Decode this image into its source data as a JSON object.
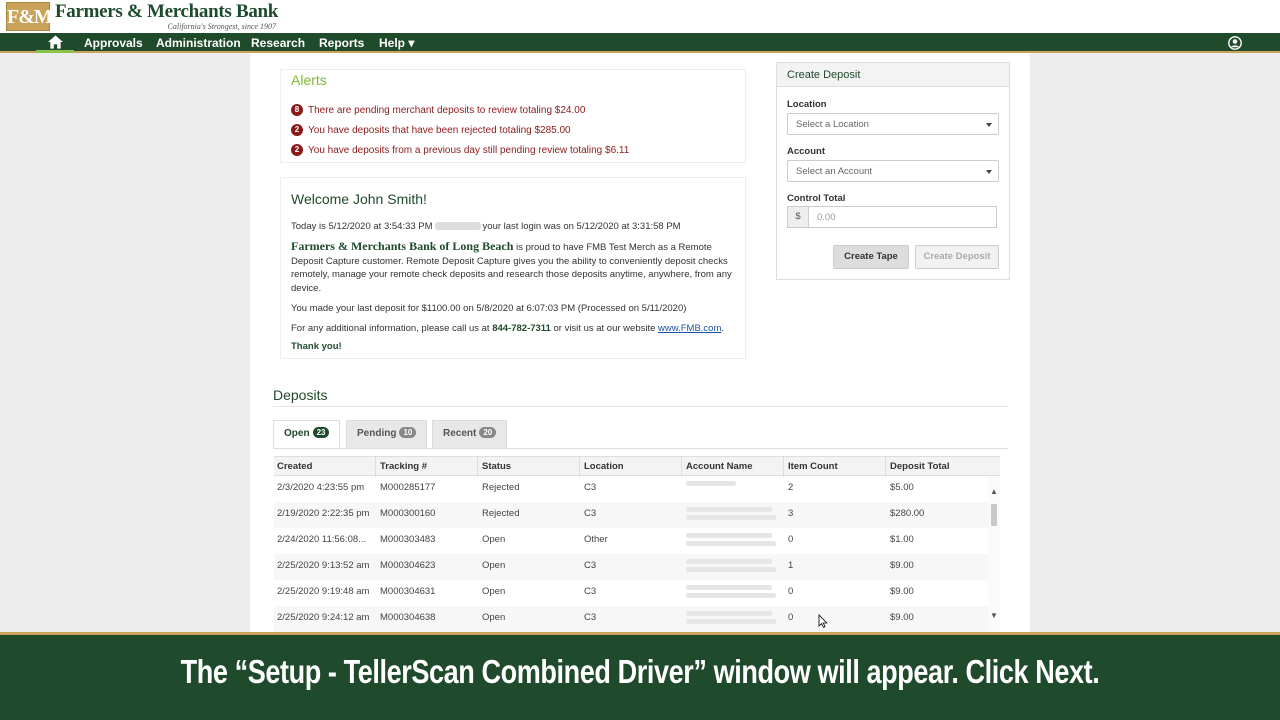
{
  "header": {
    "logo_mark": "F&M",
    "bank_name": "Farmers & Merchants Bank",
    "tagline": "California's Strongest, since 1907"
  },
  "nav": {
    "items": [
      "Approvals",
      "Administration",
      "Research",
      "Reports",
      "Help ▾"
    ]
  },
  "alerts": {
    "title": "Alerts",
    "items": [
      {
        "count": "8",
        "text": "There are pending merchant deposits to review totaling $24.00"
      },
      {
        "count": "2",
        "text": "You have deposits that have been rejected totaling $285.00"
      },
      {
        "count": "2",
        "text": "You have deposits from a previous day still pending review totaling $6.11"
      }
    ]
  },
  "welcome": {
    "title": "Welcome John Smith!",
    "today_prefix": "Today is 5/12/2020 at 3:54:33 PM",
    "today_suffix": "your last login was on 5/12/2020 at 3:31:58 PM",
    "bank_full": "Farmers & Merchants Bank of Long Beach",
    "intro": "is proud to have FMB Test Merch as a Remote Deposit Capture customer. Remote Deposit Capture gives you the ability to conveniently deposit checks remotely, manage your remote check deposits and research those deposits anytime, anywhere, from any device.",
    "last_deposit": "You made your last deposit for $1100.00 on 5/8/2020 at 6:07:03 PM (Processed on 5/11/2020)",
    "info_prefix": "For any additional information, please call us at",
    "phone": "844-782-7311",
    "info_mid": "or visit us at our website",
    "website": "www.FMB.com",
    "thanks": "Thank you!"
  },
  "create_deposit": {
    "title": "Create Deposit",
    "location_label": "Location",
    "location_placeholder": "Select a Location",
    "account_label": "Account",
    "account_placeholder": "Select an Account",
    "control_label": "Control Total",
    "currency": "$",
    "control_placeholder": "0.00",
    "create_tape": "Create Tape",
    "create_deposit": "Create Deposit"
  },
  "deposits": {
    "title": "Deposits",
    "tabs": [
      {
        "label": "Open",
        "count": "23"
      },
      {
        "label": "Pending",
        "count": "10"
      },
      {
        "label": "Recent",
        "count": "20"
      }
    ],
    "columns": [
      "Created",
      "Tracking #",
      "Status",
      "Location",
      "Account Name",
      "Item Count",
      "Deposit Total"
    ],
    "rows": [
      {
        "created": "2/3/2020 4:23:55 pm",
        "tracking": "M000285177",
        "status": "Rejected",
        "location": "C3",
        "items": "2",
        "total": "$5.00"
      },
      {
        "created": "2/19/2020 2:22:35 pm",
        "tracking": "M000300160",
        "status": "Rejected",
        "location": "C3",
        "items": "3",
        "total": "$280.00"
      },
      {
        "created": "2/24/2020 11:56:08...",
        "tracking": "M000303483",
        "status": "Open",
        "location": "Other",
        "items": "0",
        "total": "$1.00"
      },
      {
        "created": "2/25/2020 9:13:52 am",
        "tracking": "M000304623",
        "status": "Open",
        "location": "C3",
        "items": "1",
        "total": "$9.00"
      },
      {
        "created": "2/25/2020 9:19:48 am",
        "tracking": "M000304631",
        "status": "Open",
        "location": "C3",
        "items": "0",
        "total": "$9.00"
      },
      {
        "created": "2/25/2020 9:24:12 am",
        "tracking": "M000304638",
        "status": "Open",
        "location": "C3",
        "items": "0",
        "total": "$9.00"
      }
    ]
  },
  "caption": "The “Setup - TellerScan Combined Driver” window will appear. Click Next.",
  "colors": {
    "brand_green": "#1f4a2c",
    "brand_gold": "#c9a35a",
    "alert_red": "#8b1a1a",
    "alerts_green": "#7cbb32"
  }
}
